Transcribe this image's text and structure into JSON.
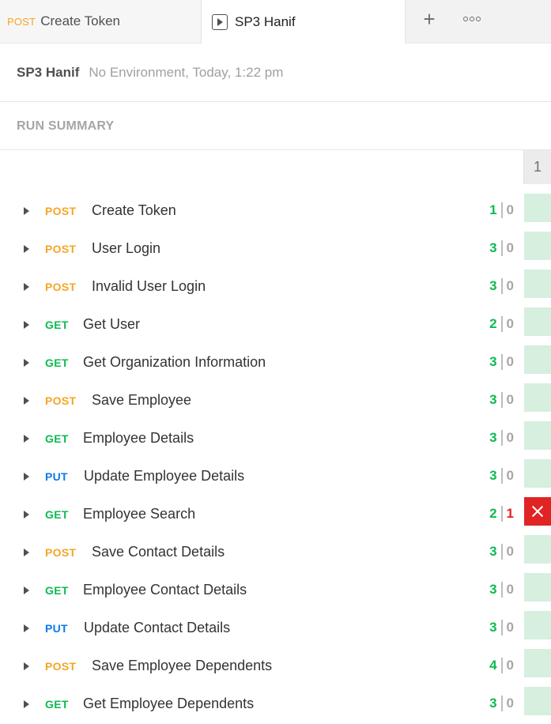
{
  "tabs": [
    {
      "method": "POST",
      "label": "Create Token"
    },
    {
      "label": "SP3 Hanif"
    }
  ],
  "header": {
    "collection": "SP3 Hanif",
    "meta": "No Environment, Today, 1:22 pm"
  },
  "summary": {
    "title": "RUN SUMMARY"
  },
  "iteration": {
    "label": "1"
  },
  "colors": {
    "GET": "#0cbb52",
    "POST": "#f5a623",
    "PUT": "#097bed",
    "pass": "#0cbb52",
    "fail": "#e02424"
  },
  "requests": [
    {
      "method": "POST",
      "name": "Create Token",
      "pass": "1",
      "fail": "0",
      "status": "pass"
    },
    {
      "method": "POST",
      "name": "User Login",
      "pass": "3",
      "fail": "0",
      "status": "pass"
    },
    {
      "method": "POST",
      "name": "Invalid User Login",
      "pass": "3",
      "fail": "0",
      "status": "pass"
    },
    {
      "method": "GET",
      "name": "Get User",
      "pass": "2",
      "fail": "0",
      "status": "pass"
    },
    {
      "method": "GET",
      "name": "Get Organization Information",
      "pass": "3",
      "fail": "0",
      "status": "pass"
    },
    {
      "method": "POST",
      "name": "Save Employee",
      "pass": "3",
      "fail": "0",
      "status": "pass"
    },
    {
      "method": "GET",
      "name": "Employee Details",
      "pass": "3",
      "fail": "0",
      "status": "pass"
    },
    {
      "method": "PUT",
      "name": "Update Employee Details",
      "pass": "3",
      "fail": "0",
      "status": "pass"
    },
    {
      "method": "GET",
      "name": "Employee Search",
      "pass": "2",
      "fail": "1",
      "status": "fail"
    },
    {
      "method": "POST",
      "name": "Save Contact Details",
      "pass": "3",
      "fail": "0",
      "status": "pass"
    },
    {
      "method": "GET",
      "name": "Employee Contact Details",
      "pass": "3",
      "fail": "0",
      "status": "pass"
    },
    {
      "method": "PUT",
      "name": "Update Contact Details",
      "pass": "3",
      "fail": "0",
      "status": "pass"
    },
    {
      "method": "POST",
      "name": "Save Employee Dependents",
      "pass": "4",
      "fail": "0",
      "status": "pass"
    },
    {
      "method": "GET",
      "name": "Get Employee Dependents",
      "pass": "3",
      "fail": "0",
      "status": "pass"
    }
  ]
}
